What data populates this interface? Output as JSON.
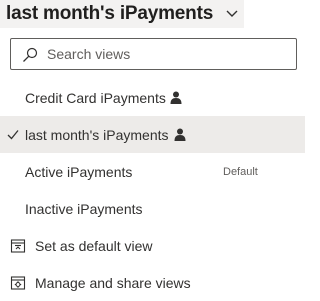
{
  "header": {
    "title": "last month's iPayments",
    "chevron_icon": "chevron-down-icon"
  },
  "search": {
    "placeholder": "Search views",
    "value": "",
    "icon": "search-icon"
  },
  "views": [
    {
      "label": "Credit Card iPayments",
      "personal": true,
      "selected": false,
      "badge": ""
    },
    {
      "label": "last month's iPayments",
      "personal": true,
      "selected": true,
      "badge": ""
    },
    {
      "label": "Active iPayments",
      "personal": false,
      "selected": false,
      "badge": "Default"
    },
    {
      "label": "Inactive iPayments",
      "personal": false,
      "selected": false,
      "badge": ""
    }
  ],
  "actions": {
    "set_default": {
      "label": "Set as default view",
      "icon": "set-default-view-icon"
    },
    "manage_share": {
      "label": "Manage and share views",
      "icon": "manage-views-icon"
    }
  },
  "colors": {
    "header_background": "#f3f2f1",
    "selected_background": "#edebe9",
    "text": "#323130",
    "secondary_text": "#605e5c"
  }
}
